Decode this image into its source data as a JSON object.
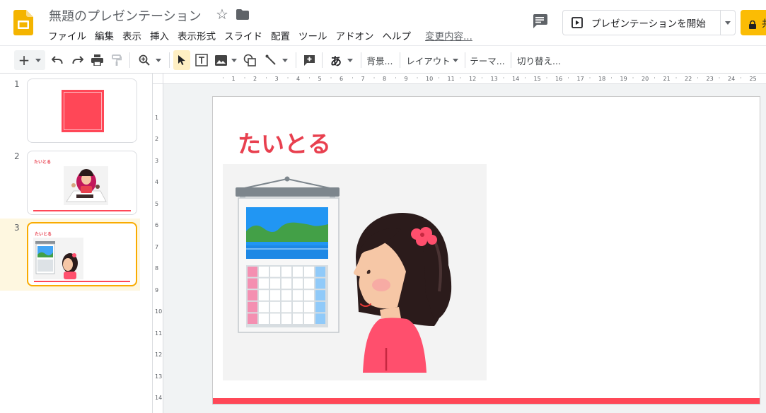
{
  "app": {
    "title": "無題のプレゼンテーション",
    "colors": {
      "accent": "#f9ab00",
      "slide_red": "#ff4757",
      "title_red": "#e8404f",
      "share_yellow": "#fbbc04"
    }
  },
  "menu": {
    "items": [
      "ファイル",
      "編集",
      "表示",
      "挿入",
      "表示形式",
      "スライド",
      "配置",
      "ツール",
      "アドオン",
      "ヘルプ"
    ],
    "last_edit": "変更内容..."
  },
  "header": {
    "present_label": "プレゼンテーションを開始",
    "share_label": "共有"
  },
  "toolbar": {
    "kana": "あ",
    "background": "背景...",
    "layout": "レイアウト",
    "theme": "テーマ...",
    "transition": "切り替え..."
  },
  "slides": [
    {
      "number": "1",
      "title": ""
    },
    {
      "number": "2",
      "title": "たいとる"
    },
    {
      "number": "3",
      "title": "たいとる"
    }
  ],
  "current_slide": {
    "index": 3,
    "title": "たいとる"
  },
  "ruler": {
    "top": [
      "1",
      "2",
      "3",
      "4",
      "5",
      "6",
      "7",
      "8",
      "9",
      "10",
      "11",
      "12",
      "13",
      "14",
      "15",
      "16",
      "17",
      "18",
      "19",
      "20",
      "21",
      "22",
      "23",
      "24",
      "25"
    ],
    "left": [
      "1",
      "2",
      "3",
      "4",
      "5",
      "6",
      "7",
      "8",
      "9",
      "10",
      "11",
      "12",
      "13",
      "14"
    ]
  }
}
